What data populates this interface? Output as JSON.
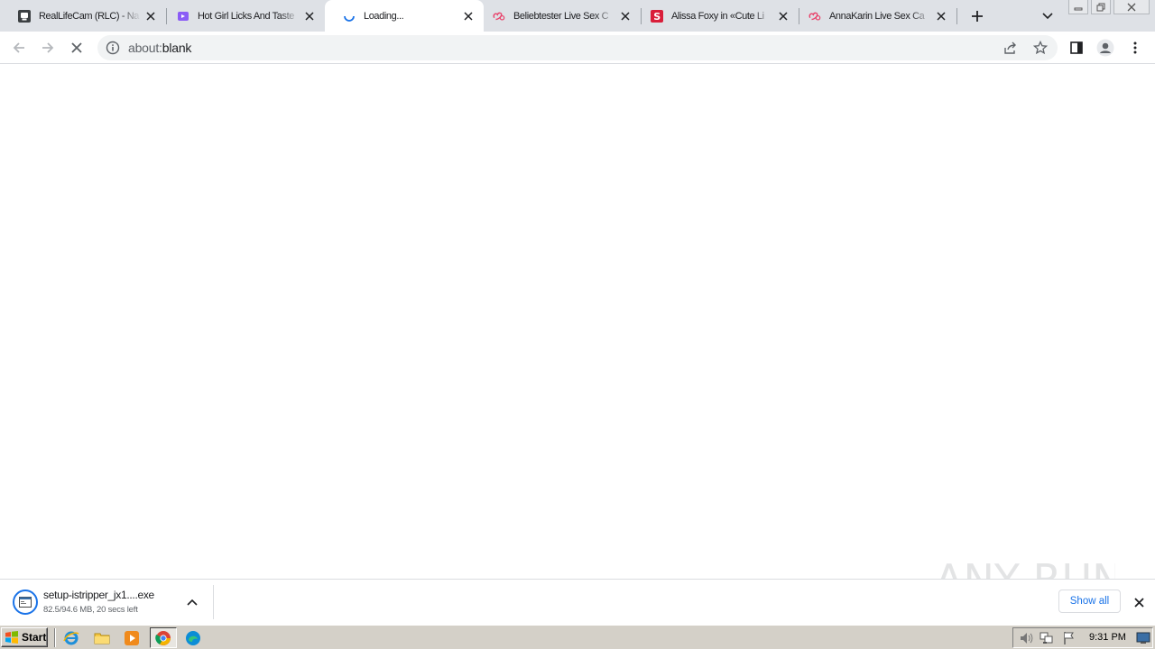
{
  "browser": {
    "tabs": [
      {
        "title": "RealLifeCam (RLC) - Na",
        "favicon": "reallifecam-icon",
        "active": false
      },
      {
        "title": "Hot Girl Licks And Taste",
        "favicon": "video-site-icon",
        "active": false
      },
      {
        "title": "Loading...",
        "favicon": "loading-spinner-icon",
        "active": true
      },
      {
        "title": "Beliebtester Live Sex C",
        "favicon": "cam-site-icon",
        "active": false
      },
      {
        "title": "Alissa Foxy in «Cute Li",
        "favicon": "s-site-icon",
        "active": false
      },
      {
        "title": "AnnaKarin Live Sex Ca",
        "favicon": "cam-site-icon",
        "active": false
      }
    ],
    "address": {
      "scheme_part": "about:",
      "host_part": "blank"
    }
  },
  "download": {
    "filename": "setup-istripper_jx1....exe",
    "status": "82.5/94.6 MB, 20 secs left",
    "show_all_label": "Show all"
  },
  "watermark": {
    "text": "ANY RUN"
  },
  "taskbar": {
    "start_label": "Start",
    "clock": "9:31 PM"
  },
  "colors": {
    "tabstrip_bg": "#dee1e6",
    "accent": "#1a73e8",
    "taskbar_bg": "#d4d0c8"
  }
}
